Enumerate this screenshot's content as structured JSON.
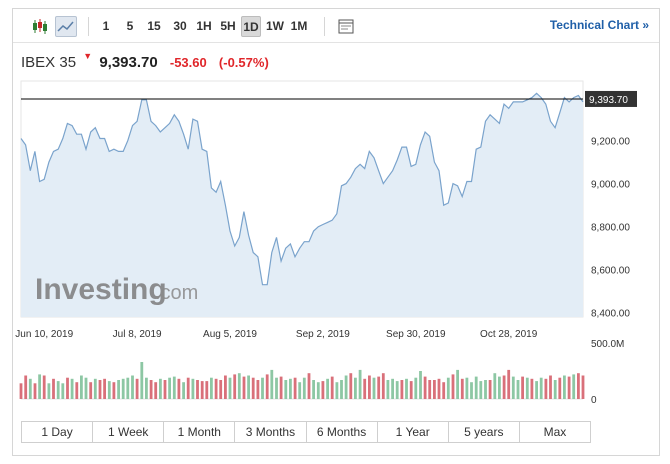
{
  "toolbar": {
    "intervals": [
      "1",
      "5",
      "15",
      "30",
      "1H",
      "5H",
      "1D",
      "1W",
      "1M"
    ],
    "active_interval": "1D",
    "technical_chart_label": "Technical Chart »"
  },
  "quote": {
    "symbol": "IBEX 35",
    "price": "9,393.70",
    "change": "-53.60",
    "change_pct": "(-0.57%)",
    "down_color": "#e0262a"
  },
  "watermark": {
    "brand": "Investing",
    "suffix": ".com"
  },
  "ranges": [
    "1 Day",
    "1 Week",
    "1 Month",
    "3 Months",
    "6 Months",
    "1 Year",
    "5 years",
    "Max"
  ],
  "chart_data": {
    "type": "area",
    "x_labels": [
      "Jun 10, 2019",
      "Jul 8, 2019",
      "Aug 5, 2019",
      "Sep 2, 2019",
      "Sep 30, 2019",
      "Oct 28, 2019"
    ],
    "x_label_index": [
      5,
      25,
      45,
      65,
      85,
      105
    ],
    "y_ticks": [
      8400,
      8600,
      8800,
      9000,
      9200
    ],
    "y_tick_labels": [
      "8,400.00",
      "8,600.00",
      "8,800.00",
      "9,000.00",
      "9,200.00"
    ],
    "ylim": [
      8380,
      9440
    ],
    "last_price": 9393.7,
    "last_price_label": "9,393.70",
    "values": [
      9210,
      9180,
      9060,
      9150,
      9010,
      9020,
      9100,
      9150,
      9160,
      9210,
      9280,
      9270,
      9230,
      9230,
      9160,
      9240,
      9260,
      9210,
      9210,
      9150,
      9160,
      9150,
      9150,
      9200,
      9270,
      9290,
      9390,
      9390,
      9290,
      9270,
      9240,
      9260,
      9280,
      9320,
      9290,
      9230,
      9160,
      9300,
      9290,
      9160,
      9150,
      8980,
      8960,
      9010,
      8900,
      8780,
      8710,
      8750,
      8870,
      8760,
      8680,
      8660,
      8530,
      8530,
      8680,
      8750,
      8640,
      8700,
      8720,
      8660,
      8700,
      8730,
      8730,
      8780,
      8800,
      8810,
      8820,
      8830,
      8860,
      8990,
      9000,
      9030,
      9070,
      9090,
      9070,
      9150,
      9120,
      9060,
      9000,
      9030,
      9060,
      9110,
      9170,
      9170,
      9080,
      9090,
      9180,
      9240,
      9220,
      9100,
      9060,
      8900,
      8910,
      9000,
      8990,
      8940,
      9010,
      9010,
      9160,
      9170,
      9290,
      9320,
      9300,
      9280,
      9370,
      9350,
      9380,
      9380,
      9380,
      9390,
      9400,
      9420,
      9400,
      9370,
      9290,
      9260,
      9330,
      9400,
      9380,
      9400,
      9410,
      9380
    ],
    "volume_axis_labels": [
      "500.0M",
      "0"
    ],
    "volume_max": 500,
    "volume": [
      140,
      210,
      180,
      140,
      220,
      210,
      140,
      180,
      160,
      140,
      190,
      180,
      150,
      210,
      190,
      150,
      180,
      170,
      180,
      160,
      150,
      170,
      180,
      190,
      210,
      180,
      330,
      190,
      170,
      150,
      180,
      170,
      190,
      200,
      180,
      150,
      190,
      180,
      170,
      160,
      160,
      190,
      180,
      170,
      210,
      190,
      220,
      230,
      200,
      210,
      190,
      170,
      190,
      220,
      260,
      190,
      200,
      170,
      180,
      190,
      150,
      190,
      230,
      170,
      150,
      160,
      180,
      200,
      150,
      170,
      210,
      230,
      190,
      260,
      180,
      210,
      190,
      200,
      230,
      170,
      180,
      160,
      170,
      180,
      160,
      190,
      250,
      200,
      170,
      170,
      180,
      150,
      190,
      220,
      260,
      180,
      190,
      150,
      200,
      160,
      170,
      170,
      230,
      200,
      210,
      260,
      200,
      170,
      200,
      190,
      180,
      160,
      190,
      180,
      210,
      170,
      190,
      210,
      200,
      220,
      230,
      210
    ],
    "volume_dir": [
      "d",
      "d",
      "u",
      "d",
      "u",
      "d",
      "u",
      "d",
      "u",
      "u",
      "d",
      "u",
      "d",
      "u",
      "u",
      "d",
      "u",
      "d",
      "d",
      "u",
      "d",
      "u",
      "u",
      "u",
      "u",
      "d",
      "u",
      "u",
      "d",
      "d",
      "u",
      "d",
      "u",
      "u",
      "d",
      "u",
      "d",
      "u",
      "d",
      "d",
      "d",
      "u",
      "d",
      "d",
      "d",
      "u",
      "d",
      "u",
      "d",
      "u",
      "d",
      "d",
      "u",
      "d",
      "u",
      "u",
      "d",
      "u",
      "u",
      "d",
      "u",
      "u",
      "d",
      "u",
      "u",
      "d",
      "u",
      "d",
      "u",
      "u",
      "u",
      "d",
      "u",
      "u",
      "d",
      "d",
      "u",
      "d",
      "d",
      "u",
      "u",
      "u",
      "d",
      "u",
      "d",
      "u",
      "u",
      "d",
      "d",
      "d",
      "d",
      "d",
      "u",
      "d",
      "u",
      "d",
      "u",
      "u",
      "u",
      "u",
      "u",
      "d",
      "u",
      "u",
      "d",
      "d",
      "u",
      "u",
      "d",
      "u",
      "d",
      "u",
      "u",
      "d",
      "d",
      "u",
      "d",
      "u",
      "d",
      "u",
      "d",
      "d"
    ],
    "colors": {
      "line": "#7aa3cc",
      "area": "#e3edf6",
      "up": "#8dc7a4",
      "down": "#d9707a",
      "price_line": "#000000"
    }
  }
}
